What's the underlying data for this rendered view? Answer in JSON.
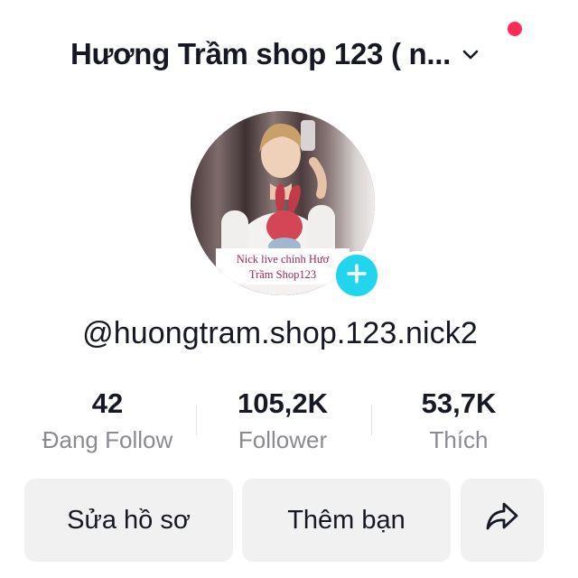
{
  "header": {
    "account_name": "Hương Trầm shop 123 ( n...",
    "chevron_icon": "chevron-down-icon",
    "notification_color": "#fe2c55"
  },
  "avatar": {
    "caption_line1": "Nick live chính Hươ",
    "caption_line2": "Trầm Shop123",
    "add_icon": "plus-icon",
    "add_color": "#20d5ec"
  },
  "profile": {
    "username": "@huongtram.shop.123.nick2"
  },
  "stats": [
    {
      "value": "42",
      "label": "Đang Follow"
    },
    {
      "value": "105,2K",
      "label": "Follower"
    },
    {
      "value": "53,7K",
      "label": "Thích"
    }
  ],
  "actions": {
    "edit_profile_label": "Sửa hồ sơ",
    "add_friend_label": "Thêm bạn",
    "share_icon": "share-icon",
    "button_bg": "#f1f1f2"
  },
  "colors": {
    "text_primary": "#161823",
    "text_secondary": "#8a8b91",
    "divider": "#e3e3e4"
  }
}
